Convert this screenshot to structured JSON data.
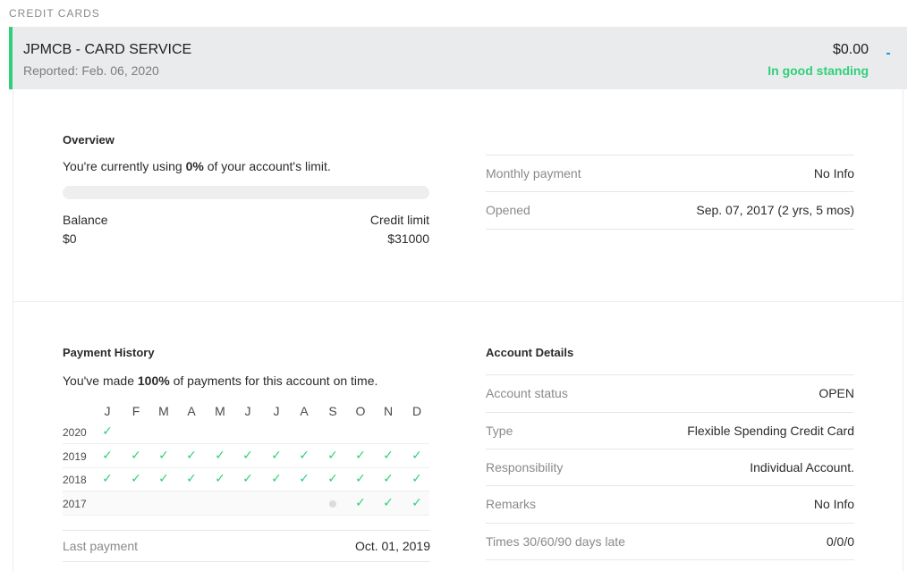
{
  "section_label": "CREDIT CARDS",
  "card": {
    "name": "JPMCB - CARD SERVICE",
    "reported": "Reported: Feb. 06, 2020",
    "amount": "$0.00",
    "standing": "In good standing",
    "toggle": "-",
    "accent_color": "#2fd07b",
    "toggle_color": "#1a8fe0"
  },
  "overview": {
    "title": "Overview",
    "usage_prefix": "You're currently using ",
    "usage_value": "0%",
    "usage_suffix": " of your account's limit.",
    "usage_fraction": 0,
    "balance_label": "Balance",
    "balance_value": "$0",
    "limit_label": "Credit limit",
    "limit_value": "$31000"
  },
  "summary_rows": [
    {
      "label": "Monthly payment",
      "value": "No Info"
    },
    {
      "label": "Opened",
      "value": "Sep. 07, 2017 (2 yrs, 5 mos)"
    }
  ],
  "payment_history": {
    "title": "Payment History",
    "intro_prefix": "You've made ",
    "intro_value": "100%",
    "intro_suffix": " of payments for this account on time.",
    "months": [
      "J",
      "F",
      "M",
      "A",
      "M",
      "J",
      "J",
      "A",
      "S",
      "O",
      "N",
      "D"
    ],
    "check_icon": "check-icon",
    "rows": [
      {
        "year": "2020",
        "marks": [
          "check",
          "",
          "",
          "",
          "",
          "",
          "",
          "",
          "",
          "",
          "",
          ""
        ]
      },
      {
        "year": "2019",
        "marks": [
          "check",
          "check",
          "check",
          "check",
          "check",
          "check",
          "check",
          "check",
          "check",
          "check",
          "check",
          "check"
        ]
      },
      {
        "year": "2018",
        "marks": [
          "check",
          "check",
          "check",
          "check",
          "check",
          "check",
          "check",
          "check",
          "check",
          "check",
          "check",
          "check"
        ]
      },
      {
        "year": "2017",
        "marks": [
          "",
          "",
          "",
          "",
          "",
          "",
          "",
          "",
          "dot",
          "check",
          "check",
          "check"
        ]
      }
    ],
    "last_payment_label": "Last payment",
    "last_payment_value": "Oct. 01, 2019"
  },
  "account_details": {
    "title": "Account Details",
    "rows": [
      {
        "label": "Account status",
        "value": "OPEN"
      },
      {
        "label": "Type",
        "value": "Flexible Spending Credit Card"
      },
      {
        "label": "Responsibility",
        "value": "Individual Account."
      },
      {
        "label": "Remarks",
        "value": "No Info"
      },
      {
        "label": "Times 30/60/90 days late",
        "value": "0/0/0"
      }
    ]
  }
}
